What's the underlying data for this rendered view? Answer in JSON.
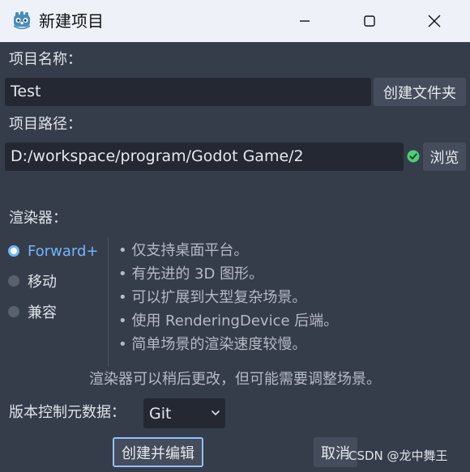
{
  "window": {
    "title": "新建项目"
  },
  "project_name": {
    "label": "项目名称：",
    "value": "Test",
    "create_folder_button": "创建文件夹"
  },
  "project_path": {
    "label": "项目路径：",
    "value": "D:/workspace/program/Godot Game/2",
    "browse_button": "浏览",
    "status": "valid"
  },
  "renderer": {
    "label": "渲染器：",
    "options": [
      {
        "label": "Forward+",
        "selected": true
      },
      {
        "label": "移动",
        "selected": false
      },
      {
        "label": "兼容",
        "selected": false
      }
    ],
    "features": [
      "• 仅支持桌面平台。",
      "• 有先进的 3D 图形。",
      "• 可以扩展到大型复杂场景。",
      "• 使用 RenderingDevice 后端。",
      "• 简单场景的渲染速度较慢。"
    ],
    "note": "渲染器可以稍后更改，但可能需要调整场景。"
  },
  "vcs": {
    "label": "版本控制元数据：",
    "selected": "Git"
  },
  "actions": {
    "create_and_edit": "创建并编辑",
    "cancel": "取消"
  },
  "watermark": "CSDN @龙中舞王",
  "colors": {
    "background": "#363d4a",
    "field": "#232833",
    "button": "#454d5c",
    "accent": "#72b6ff",
    "valid": "#4ccf74"
  }
}
